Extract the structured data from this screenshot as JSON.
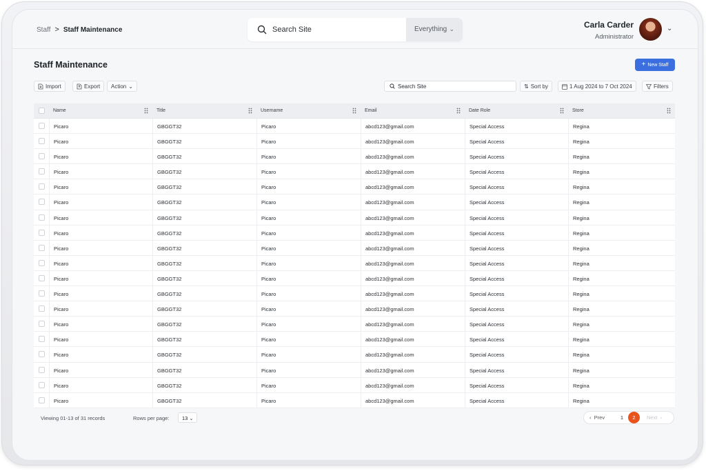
{
  "breadcrumb": {
    "parent": "Staff",
    "separator": ">",
    "current": "Staff Maintenance"
  },
  "top_search": {
    "placeholder": "Search Site",
    "scope": "Everything"
  },
  "user": {
    "name": "Carla Carder",
    "role": "Administrator"
  },
  "page": {
    "title": "Staff Maintenance",
    "new_button": "New Staff"
  },
  "toolbar": {
    "import_label": "Import",
    "export_label": "Export",
    "action_label": "Action",
    "search_placeholder": "Search Site",
    "sort_label": "Sort by",
    "date_range": "1 Aug 2024 to 7 Oct 2024",
    "filters_label": "Filters"
  },
  "table": {
    "columns": [
      "Name",
      "Title",
      "Username",
      "Email",
      "Date Role",
      "Store"
    ],
    "rows": [
      [
        "Picaro",
        "GBGGT32",
        "Picaro",
        "abcd123@gmail.com",
        "Special Access",
        "Regina"
      ],
      [
        "Picaro",
        "GBGGT32",
        "Picaro",
        "abcd123@gmail.com",
        "Special Access",
        "Regina"
      ],
      [
        "Picaro",
        "GBGGT32",
        "Picaro",
        "abcd123@gmail.com",
        "Special Access",
        "Regina"
      ],
      [
        "Picaro",
        "GBGGT32",
        "Picaro",
        "abcd123@gmail.com",
        "Special Access",
        "Regina"
      ],
      [
        "Picaro",
        "GBGGT32",
        "Picaro",
        "abcd123@gmail.com",
        "Special Access",
        "Regina"
      ],
      [
        "Picaro",
        "GBGGT32",
        "Picaro",
        "abcd123@gmail.com",
        "Special Access",
        "Regina"
      ],
      [
        "Picaro",
        "GBGGT32",
        "Picaro",
        "abcd123@gmail.com",
        "Special Access",
        "Regina"
      ],
      [
        "Picaro",
        "GBGGT32",
        "Picaro",
        "abcd123@gmail.com",
        "Special Access",
        "Regina"
      ],
      [
        "Picaro",
        "GBGGT32",
        "Picaro",
        "abcd123@gmail.com",
        "Special Access",
        "Regina"
      ],
      [
        "Picaro",
        "GBGGT32",
        "Picaro",
        "abcd123@gmail.com",
        "Special Access",
        "Regina"
      ],
      [
        "Picaro",
        "GBGGT32",
        "Picaro",
        "abcd123@gmail.com",
        "Special Access",
        "Regina"
      ],
      [
        "Picaro",
        "GBGGT32",
        "Picaro",
        "abcd123@gmail.com",
        "Special Access",
        "Regina"
      ],
      [
        "Picaro",
        "GBGGT32",
        "Picaro",
        "abcd123@gmail.com",
        "Special Access",
        "Regina"
      ],
      [
        "Picaro",
        "GBGGT32",
        "Picaro",
        "abcd123@gmail.com",
        "Special Access",
        "Regina"
      ],
      [
        "Picaro",
        "GBGGT32",
        "Picaro",
        "abcd123@gmail.com",
        "Special Access",
        "Regina"
      ],
      [
        "Picaro",
        "GBGGT32",
        "Picaro",
        "abcd123@gmail.com",
        "Special Access",
        "Regina"
      ],
      [
        "Picaro",
        "GBGGT32",
        "Picaro",
        "abcd123@gmail.com",
        "Special Access",
        "Regina"
      ],
      [
        "Picaro",
        "GBGGT32",
        "Picaro",
        "abcd123@gmail.com",
        "Special Access",
        "Regina"
      ],
      [
        "Picaro",
        "GBGGT32",
        "Picaro",
        "abcd123@gmail.com",
        "Special Access",
        "Regina"
      ]
    ]
  },
  "footer": {
    "viewing": "Viewing 01-13 of 31 records",
    "rows_per_page_label": "Rows per page:",
    "rows_per_page_value": "13",
    "prev": "Prev",
    "pages": [
      "1",
      "2"
    ],
    "current_page": "2",
    "next": "Next"
  },
  "colors": {
    "accent": "#3b6fe0",
    "active_page": "#e8531e"
  }
}
